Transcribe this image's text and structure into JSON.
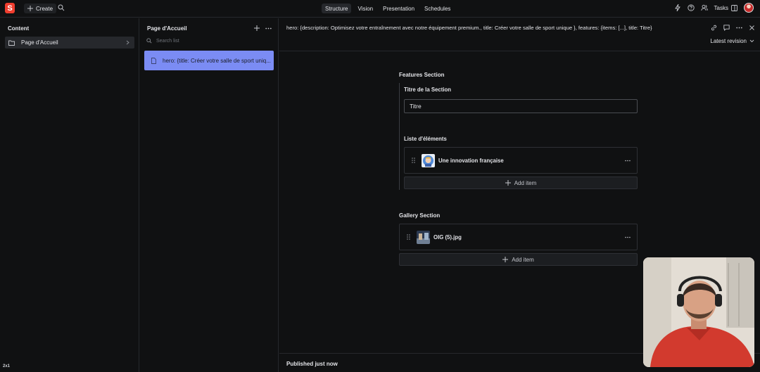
{
  "topbar": {
    "logo_letter": "S",
    "create_label": "Create",
    "tabs": [
      "Structure",
      "Vision",
      "Presentation",
      "Schedules"
    ],
    "active_tab": "Structure",
    "tasks_label": "Tasks"
  },
  "content_pane": {
    "title": "Content",
    "items": [
      {
        "label": "Page d'Accueil"
      }
    ]
  },
  "page_pane": {
    "title": "Page d'Accueil",
    "search_placeholder": "Search list",
    "documents": [
      {
        "label": "hero: {title: Créer votre salle de sport uniq..."
      }
    ]
  },
  "editor": {
    "header": "hero: {description: Optimisez votre entraînement avec notre équipement premium., title: Créer votre salle de sport unique }, features: {items: [...], title: Titre}",
    "revision": "Latest revision",
    "features_section": {
      "title": "Features Section",
      "title_field_label": "Titre de la Section",
      "title_field_value": "Titre",
      "list_label": "Liste d'éléments",
      "items": [
        {
          "title": "Une innovation française"
        }
      ],
      "add_item_label": "Add item"
    },
    "gallery_section": {
      "title": "Gallery Section",
      "items": [
        {
          "title": "OIG (5).jpg"
        }
      ],
      "add_item_label": "Add item"
    },
    "status": "Published just now"
  },
  "overlay": {
    "zoom_badge": "2x1"
  },
  "colors": {
    "accent_brand": "#f03e2f",
    "selected_document": "#7b8cf4",
    "background": "#101112"
  }
}
